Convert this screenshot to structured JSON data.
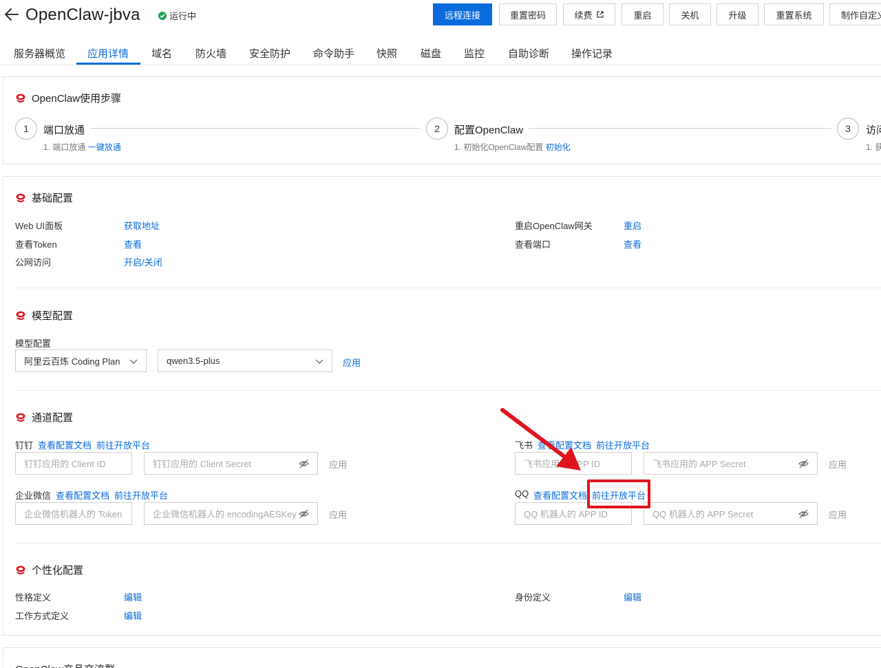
{
  "header": {
    "title": "OpenClaw-jbva",
    "status": "运行中",
    "buttons": {
      "remote": "远程连接",
      "reset_password": "重置密码",
      "renew": "续费",
      "restart": "重启",
      "shutdown": "关机",
      "upgrade": "升级",
      "reset_system": "重置系统",
      "make_custom": "制作自定义"
    }
  },
  "tabs": [
    "服务器概览",
    "应用详情",
    "域名",
    "防火墙",
    "安全防护",
    "命令助手",
    "快照",
    "磁盘",
    "监控",
    "自助诊断",
    "操作记录"
  ],
  "steps": {
    "title": "OpenClaw使用步骤",
    "items": [
      {
        "num": "1",
        "label": "端口放通",
        "desc": "1. 端口放通",
        "link": "一键放通"
      },
      {
        "num": "2",
        "label": "配置OpenClaw",
        "desc": "1. 初始化OpenClaw配置",
        "link": "初始化"
      },
      {
        "num": "3",
        "label": "访问",
        "desc": "1. 获"
      }
    ]
  },
  "basic": {
    "title": "基础配置",
    "webui_label": "Web UI面板",
    "webui_link": "获取地址",
    "token_label": "查看Token",
    "token_link": "查看",
    "public_label": "公网访问",
    "public_link": "开启/关闭",
    "gateway_label": "重启OpenClaw网关",
    "gateway_link": "重启",
    "port_label": "查看端口",
    "port_link": "查看"
  },
  "model": {
    "title": "模型配置",
    "label": "模型配置",
    "provider": "阿里云百炼 Coding Plan",
    "model": "qwen3.5-plus",
    "apply": "应用"
  },
  "channel": {
    "title": "通道配置",
    "doc": "查看配置文档",
    "platform": "前往开放平台",
    "apply": "应用",
    "dingtalk": {
      "name": "钉钉",
      "id_ph": "钉钉应用的 Client ID",
      "secret_ph": "钉钉应用的 Client Secret"
    },
    "feishu": {
      "name": "飞书",
      "id_ph": "飞书应用的 APP ID",
      "secret_ph": "飞书应用的 APP Secret"
    },
    "wecom": {
      "name": "企业微信",
      "id_ph": "企业微信机器人的 Token",
      "secret_ph": "企业微信机器人的 encodingAESKey"
    },
    "qq": {
      "name": "QQ",
      "id_ph": "QQ 机器人的 APP ID",
      "secret_ph": "QQ 机器人的 APP Secret"
    }
  },
  "persona": {
    "title": "个性化配置",
    "personality_label": "性格定义",
    "personality_link": "编辑",
    "identity_label": "身份定义",
    "identity_link": "编辑",
    "workstyle_label": "工作方式定义",
    "workstyle_link": "编辑"
  },
  "community": {
    "title": "OpenClaw产品交流群"
  },
  "colors": {
    "accent": "#0a6cdc",
    "annotation": "#e0141e",
    "running": "#1fa24a"
  }
}
